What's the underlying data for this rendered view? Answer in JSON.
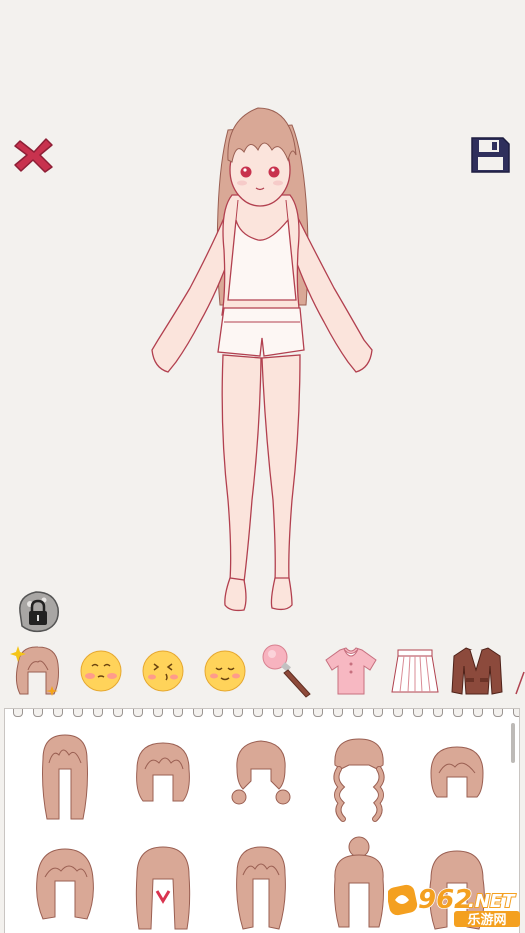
{
  "toolbar": {
    "close_icon": "close-x-icon",
    "save_icon": "floppy-disk-icon",
    "lock_icon": "padlock-icon",
    "accent_red": "#c8324e",
    "save_navy": "#2f2f5c"
  },
  "categories": [
    {
      "id": "hair",
      "icon": "hair-icon",
      "selected": true
    },
    {
      "id": "face-expression-1",
      "icon": "blush-face-icon"
    },
    {
      "id": "face-expression-2",
      "icon": "wink-face-icon"
    },
    {
      "id": "face-expression-3",
      "icon": "smile-face-icon"
    },
    {
      "id": "makeup",
      "icon": "makeup-brush-icon"
    },
    {
      "id": "tops",
      "icon": "tshirt-icon"
    },
    {
      "id": "skirts",
      "icon": "pleated-skirt-icon"
    },
    {
      "id": "jackets",
      "icon": "jacket-icon"
    }
  ],
  "hair_options": [
    {
      "style": "long-straight"
    },
    {
      "style": "bob"
    },
    {
      "style": "low-pigtails"
    },
    {
      "style": "braids"
    },
    {
      "style": "short-bob"
    },
    {
      "style": "medium-flip"
    },
    {
      "style": "long-with-bow"
    },
    {
      "style": "long-layered"
    },
    {
      "style": "top-bun"
    },
    {
      "style": "wavy"
    }
  ],
  "colors": {
    "background": "#f3f1ee",
    "hair": "#d9a896",
    "hair_line": "#9a5f52",
    "skin": "#fbe4dc",
    "outline": "#b2404f"
  },
  "watermark": {
    "number": "962",
    "suffix": ".NET",
    "subtitle": "乐游网"
  }
}
